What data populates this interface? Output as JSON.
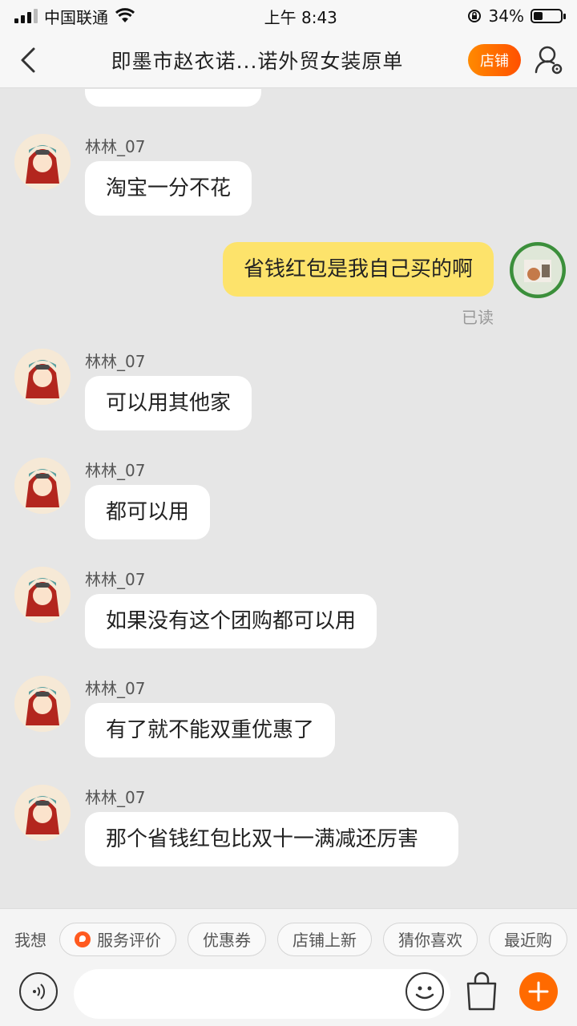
{
  "status_bar": {
    "carrier": "中国联通",
    "time": "上午 8:43",
    "battery": "34%"
  },
  "nav": {
    "title": "即墨市赵衣诺...诺外贸女装原单",
    "store_label": "店铺"
  },
  "messages": [
    {
      "side": "left",
      "sender": "林林_07",
      "text": "淘宝一分不花"
    },
    {
      "side": "right",
      "text": "省钱红包是我自己买的啊",
      "status": "已读"
    },
    {
      "side": "left",
      "sender": "林林_07",
      "text": "可以用其他家"
    },
    {
      "side": "left",
      "sender": "林林_07",
      "text": "都可以用"
    },
    {
      "side": "left",
      "sender": "林林_07",
      "text": "如果没有这个团购都可以用"
    },
    {
      "side": "left",
      "sender": "林林_07",
      "text": "有了就不能双重优惠了"
    },
    {
      "side": "left",
      "sender": "林林_07",
      "text": "那个省钱红包比双十一满减还厉害"
    }
  ],
  "quick_bar": {
    "label": "我想",
    "chips": [
      "服务评价",
      "优惠券",
      "店铺上新",
      "猜你喜欢",
      "最近购"
    ]
  },
  "colors": {
    "accent": "#ff5000",
    "bubble_self": "#fde36b",
    "bubble_other": "#ffffff",
    "background": "#e6e6e6"
  },
  "icons": [
    "back-icon",
    "profile-settings-icon",
    "voice-icon",
    "emoji-icon",
    "shopping-bag-icon",
    "plus-icon",
    "service-review-icon"
  ]
}
